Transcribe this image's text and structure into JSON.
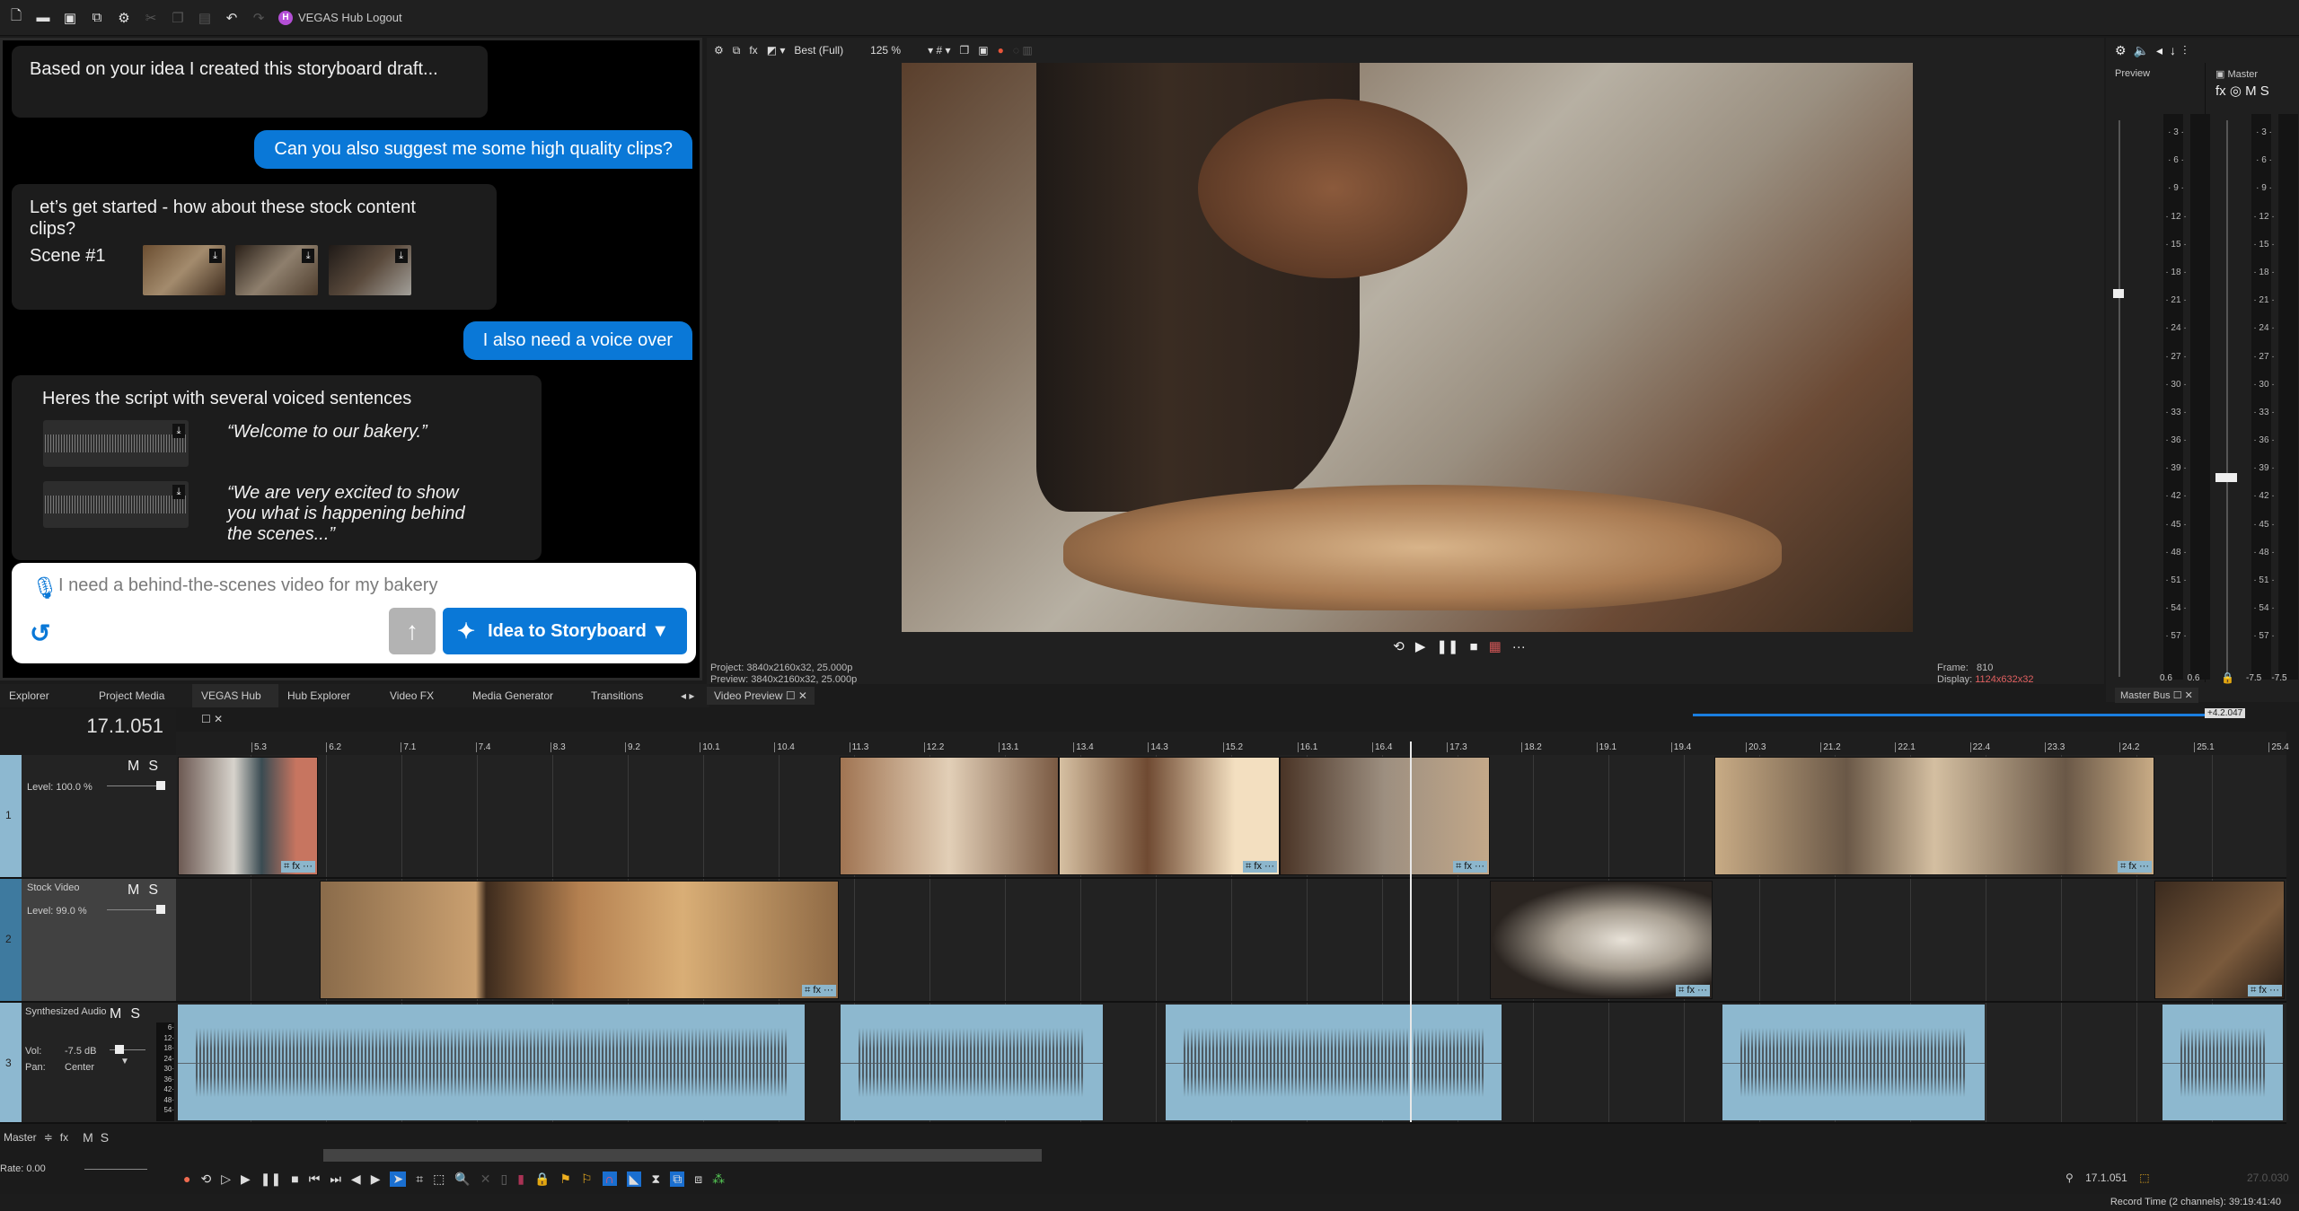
{
  "topbar": {
    "icons": [
      "new-file-icon",
      "open-folder-icon",
      "save-icon",
      "external-window-icon",
      "settings-icon",
      "cut-icon",
      "copy-icon",
      "paste-icon",
      "undo-icon",
      "redo-icon"
    ],
    "hub_badge": "H",
    "hub_label": "VEGAS Hub Logout"
  },
  "chat": {
    "messages": [
      {
        "role": "assistant",
        "text": "Based on your idea I created this storyboard draft..."
      },
      {
        "role": "user",
        "text": "Can you also suggest me some high quality clips?"
      },
      {
        "role": "assistant",
        "text": "Let’s get started - how about these stock content clips?",
        "scene_label": "Scene #1",
        "thumbnails": 3
      },
      {
        "role": "user",
        "text": "I also need a voice over"
      },
      {
        "role": "assistant",
        "text": "Heres the script with several voiced sentences",
        "voice_lines": [
          "“Welcome to our bakery.”",
          "“We are very excited to show you what is happening behind the scenes...”"
        ]
      }
    ],
    "input_value": "I need a behind-the-scenes video for my bakery",
    "send_icon": "↑",
    "storyboard_button": "Idea to Storyboard ▼"
  },
  "dock_tabs": [
    "Explorer",
    "Project Media",
    "VEGAS Hub",
    "Hub Explorer",
    "Video FX",
    "Media Generator",
    "Transitions"
  ],
  "preview": {
    "quality": "Best (Full)",
    "zoom": "125 %",
    "tab_label": "Video Preview",
    "project": "Project:  3840x2160x32, 25.000p",
    "preview": "Preview:  3840x2160x32, 25.000p",
    "frame_label": "Frame:",
    "frame_value": "810",
    "display_label": "Display:",
    "display_value": "1124x632x32"
  },
  "master_bus": {
    "preview_label": "Preview",
    "master_label": "Master",
    "controls": "fx ◎ M S",
    "scale": [
      "-3",
      "-6",
      "-9",
      "-12",
      "-15",
      "-18",
      "-21",
      "-24",
      "-27",
      "-30",
      "-33",
      "-36",
      "-39",
      "-42",
      "-45",
      "-48",
      "-51",
      "-54",
      "-57"
    ],
    "preview_levels": [
      "0.6",
      "0.6"
    ],
    "master_levels": [
      "-7.5",
      "-7.5"
    ],
    "tab_label": "Master Bus"
  },
  "timeline": {
    "timecode": "17.1.051",
    "loop_length": "+4.2.047",
    "ruler": [
      "5.3",
      "6.2",
      "7.1",
      "7.4",
      "8.3",
      "9.2",
      "10.1",
      "10.4",
      "11.3",
      "12.2",
      "13.1",
      "13.4",
      "14.3",
      "15.2",
      "16.1",
      "16.4",
      "17.3",
      "18.2",
      "19.1",
      "19.4",
      "20.3",
      "21.2",
      "22.1",
      "22.4",
      "23.3",
      "24.2",
      "25.1",
      "25.4"
    ],
    "tracks": [
      {
        "num": "1",
        "name": "",
        "level": "Level: 100.0 %"
      },
      {
        "num": "2",
        "name": "Stock Video",
        "level": "Level:  99.0 %"
      },
      {
        "num": "3",
        "name": "Synthesized Audio",
        "vol_label": "Vol:",
        "vol": "-7.5 dB",
        "pan_label": "Pan:",
        "pan": "Center",
        "meter": [
          "6",
          "12",
          "18",
          "24",
          "30",
          "36",
          "42",
          "48",
          "54"
        ]
      }
    ],
    "master_label": "Master",
    "rate": "Rate: 0.00",
    "cursor_time": "17.1.051",
    "end_time": "27.0.030",
    "clip_tag": "⌗ fx ···"
  },
  "status": {
    "record_time": "Record Time (2 channels): 39:19:41:40"
  }
}
